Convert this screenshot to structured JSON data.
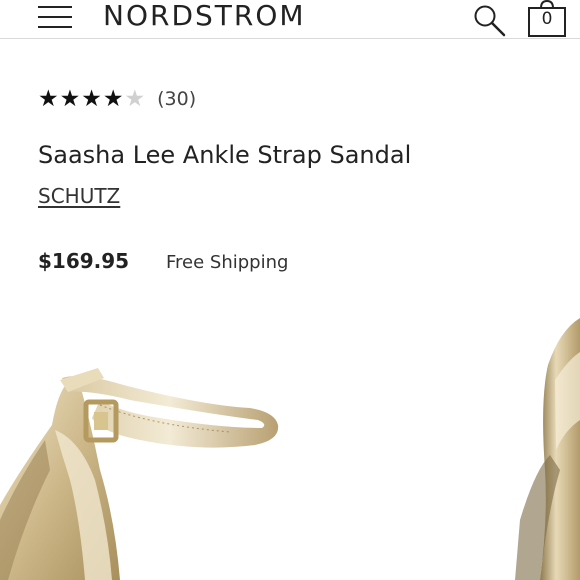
{
  "header": {
    "brand": "NORDSTROM",
    "bag_count": "0"
  },
  "product": {
    "rating": 4,
    "rating_max": 5,
    "review_count": "(30)",
    "title": "Saasha Lee Ankle Strap Sandal",
    "brand": "SCHUTZ",
    "price": "$169.95",
    "shipping": "Free Shipping"
  },
  "icons": {
    "menu": "hamburger-menu-icon",
    "search": "search-icon",
    "bag": "shopping-bag-icon"
  },
  "colors": {
    "accent": "#222222",
    "star_empty": "#d0d0d0",
    "metallic_gold": "#d8c69e"
  }
}
